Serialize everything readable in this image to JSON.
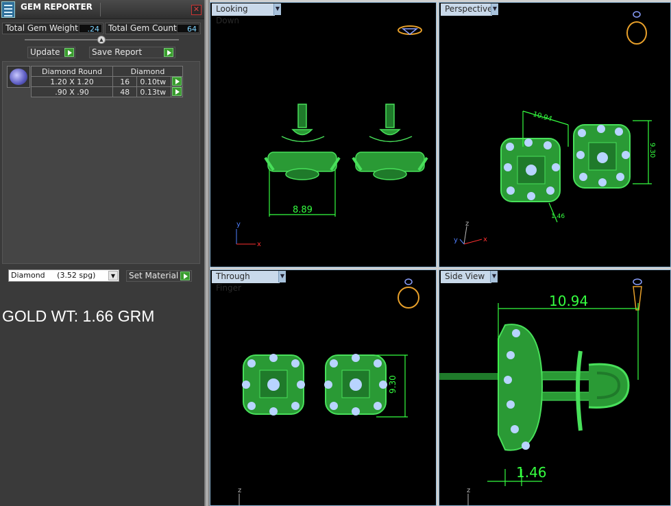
{
  "panel": {
    "title": "GEM REPORTER",
    "close": "✕",
    "total_weight_label": "Total Gem Weight",
    "total_weight_value": ".24",
    "total_count_label": "Total Gem Count",
    "total_count_value": "64",
    "update_label": "Update",
    "save_report_label": "Save Report",
    "table": {
      "headers": [
        "Diamond Round",
        "Diamond"
      ],
      "rows": [
        {
          "size": "1.20 X 1.20",
          "count": "16",
          "weight": "0.10tw"
        },
        {
          "size": ".90 X .90",
          "count": "48",
          "weight": "0.13tw"
        }
      ]
    },
    "material_value": "Diamond     (3.52 spg)",
    "set_material_label": "Set Material",
    "gold_weight": "GOLD WT: 1.66 GRM"
  },
  "viewports": {
    "top_left": {
      "label": "Looking Down",
      "dimension": "8.89"
    },
    "top_right": {
      "label": "Perspective",
      "dimension_a": "10.94",
      "dimension_b": "9.30",
      "dimension_c": "1.46"
    },
    "bottom_left": {
      "label": "Through Finger",
      "dimension": "9.30"
    },
    "bottom_right": {
      "label": "Side View",
      "dimension_a": "10.94",
      "dimension_b": "1.46"
    }
  },
  "axes": {
    "x": "x",
    "y": "y",
    "z": "z"
  },
  "colors": {
    "model_green": "#48e05a",
    "dimension_green": "#35ff40",
    "gem_blue": "#b8d4ff",
    "gold_icon": "#e8a02a",
    "viewport_label_bg": "#c9d9ea"
  }
}
